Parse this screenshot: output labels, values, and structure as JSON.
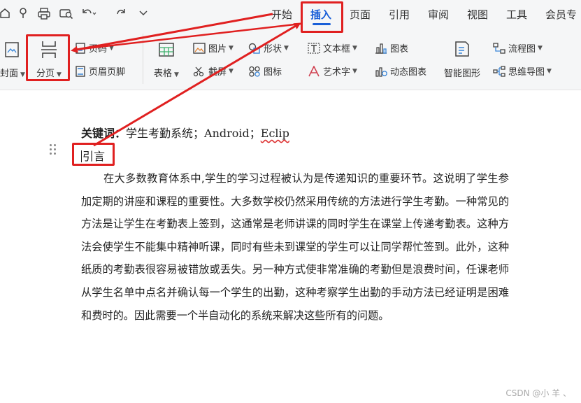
{
  "quick_access": [
    "home-icon",
    "format-painter-icon",
    "print-icon",
    "print-preview-icon",
    "undo-icon",
    "redo-icon",
    "more-icon"
  ],
  "menu": {
    "tabs": [
      "开始",
      "插入",
      "页面",
      "引用",
      "审阅",
      "视图",
      "工具",
      "会员专"
    ],
    "active_tab": "插入"
  },
  "ribbon": {
    "cover_label": "封面",
    "page_break_label": "分页",
    "blank_page_label": "页码",
    "header_footer_label": "页眉页脚",
    "table_label": "表格",
    "picture_label": "图片",
    "screenshot_label": "截屏",
    "shape_label": "形状",
    "icon_label": "图标",
    "textbox_label": "文本框",
    "wordart_label": "艺术字",
    "chart_label": "图表",
    "dynamic_chart_label": "动态图表",
    "smart_graphic_label": "智能图形",
    "flowchart_label": "流程图",
    "mindmap_label": "思维导图"
  },
  "document": {
    "keywords_label": "关键词：",
    "keywords_value": "学生考勤系统；Android；",
    "keywords_misspelled": "Eclip",
    "section_heading": "引言",
    "paragraph": "在大多数教育体系中,学生的学习过程被认为是传递知识的重要环节。这说明了学生参加定期的讲座和课程的重要性。大多数学校仍然采用传统的方法进行学生考勤。一种常见的方法是让学生在考勤表上签到，这通常是老师讲课的同时学生在课堂上传递考勤表。这种方法会使学生不能集中精神听课，同时有些未到课堂的学生可以让同学帮忙签到。此外，这种纸质的考勤表很容易被错放或丢失。另一种方式使非常准确的考勤但是浪费时间，任课老师从学生名单中点名并确认每一个学生的出勤，这种考察学生出勤的手动方法已经证明是困难和费时的。因此需要一个半自动化的系统来解决这些所有的问题。"
  },
  "watermark": "CSDN @小 羊 、",
  "colors": {
    "annotation_red": "#e02020",
    "active_tab_blue": "#1a5fd8"
  }
}
